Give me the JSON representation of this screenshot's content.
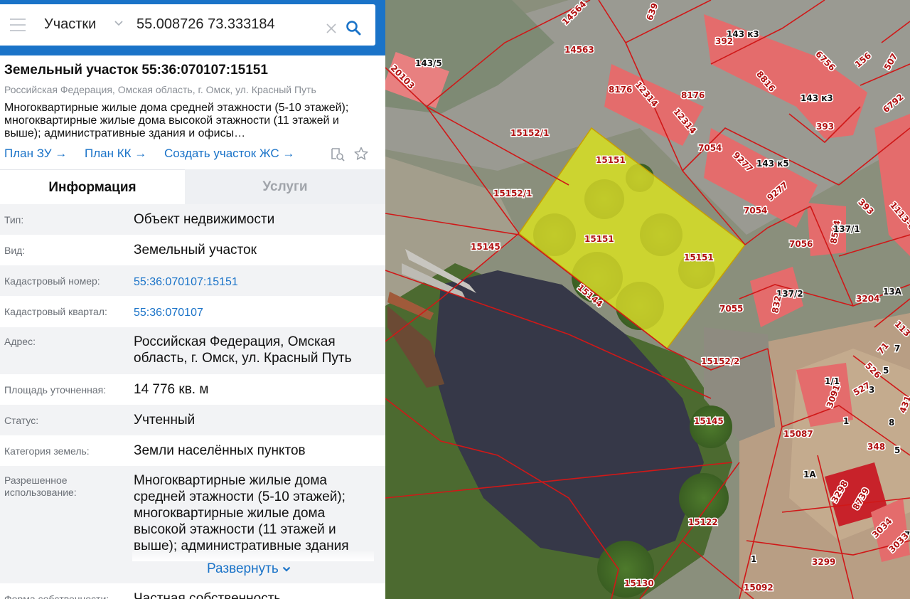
{
  "search": {
    "layer": "Участки",
    "coordinates": "55.008726 73.333184"
  },
  "parcel": {
    "title": "Земельный участок 55:36:070107:15151",
    "address_short": "Российская Федерация, Омская область, г. Омск, ул. Красный Путь",
    "description": "Многоквартирные жилые дома средней этажности (5-10 этажей); многоквартирные жилые дома высокой этажности (11 этажей и выше); административные здания и офисы…",
    "links": [
      "План ЗУ →",
      "План КК →",
      "Создать участок ЖС →"
    ]
  },
  "tabs": {
    "info": "Информация",
    "services": "Услуги"
  },
  "rows": [
    {
      "label": "Тип:",
      "value": "Объект недвижимости"
    },
    {
      "label": "Вид:",
      "value": "Земельный участок"
    },
    {
      "label": "Кадастровый номер:",
      "value": "55:36:070107:15151"
    },
    {
      "label": "Кадастровый квартал:",
      "value": "55:36:070107"
    },
    {
      "label": "Адрес:",
      "value": "Российская Федерация, Омская область, г. Омск, ул. Красный Путь"
    },
    {
      "label": "Площадь уточненная:",
      "value": "14 776 кв. м"
    },
    {
      "label": "Статус:",
      "value": "Учтенный"
    },
    {
      "label": "Категория земель:",
      "value": "Земли населённых пунктов"
    },
    {
      "label": "Разрешенное использование:",
      "value": "Многоквартирные жилые дома средней этажности (5-10 этажей); многоквартирные жилые дома высокой этажности (11 этажей и выше); административные здания"
    },
    {
      "label": "Форма собственности:",
      "value": "Частная собственность"
    }
  ],
  "expand_label": "Развернуть",
  "map_labels": {
    "l1": "143/5",
    "l2": "20103",
    "l3": "14563",
    "l4": "14564",
    "l5": "639",
    "l6": "143 к3",
    "l7": "392",
    "l8": "156",
    "l9": "507",
    "l10": "6756",
    "l11": "8816",
    "l12": "143 к3",
    "l13": "6792",
    "l14": "8176",
    "l15": "12314",
    "l16": "8176",
    "l17": "12314",
    "l18": "393",
    "l19": "15152/1",
    "l20": "15151",
    "l21": "7054",
    "l22": "9277",
    "l23": "143 к5",
    "l24": "9277",
    "l25": "15152/1",
    "l26": "7054",
    "l27": "393",
    "l28": "1113-6",
    "l29": "15151",
    "l30": "15151",
    "l31": "15145",
    "l32": "8544",
    "l33": "137/1",
    "l34": "7056",
    "l35": "15144",
    "l36": "137/2",
    "l37": "832",
    "l38": "7055",
    "l39": "3204",
    "l40": "13А",
    "l41": "113",
    "l42": "7",
    "l43": "71",
    "l44": "15152/2",
    "l45": "526",
    "l46": "5",
    "l47": "1/1",
    "l48": "527",
    "l49": "3",
    "l50": "3091",
    "l51": "431",
    "l52": "15145",
    "l53": "1",
    "l54": "8",
    "l55": "15087",
    "l56": "348",
    "l57": "5",
    "l58": "1А",
    "l59": "3298",
    "l60": "8739",
    "l61": "3034",
    "l62": "7",
    "l63": "3033",
    "l64": "15122",
    "l65": "1",
    "l66": "3299",
    "l67": "15130",
    "l68": "15092"
  },
  "colors": {
    "accent": "#1a73c8",
    "parcel_fill": "#e8e62a",
    "boundary": "#d01818"
  },
  "icons": [
    "menu-icon",
    "chevron-down-icon",
    "clear-icon",
    "search-icon",
    "chevron-left-icon",
    "zoom-to-icon",
    "star-icon"
  ]
}
